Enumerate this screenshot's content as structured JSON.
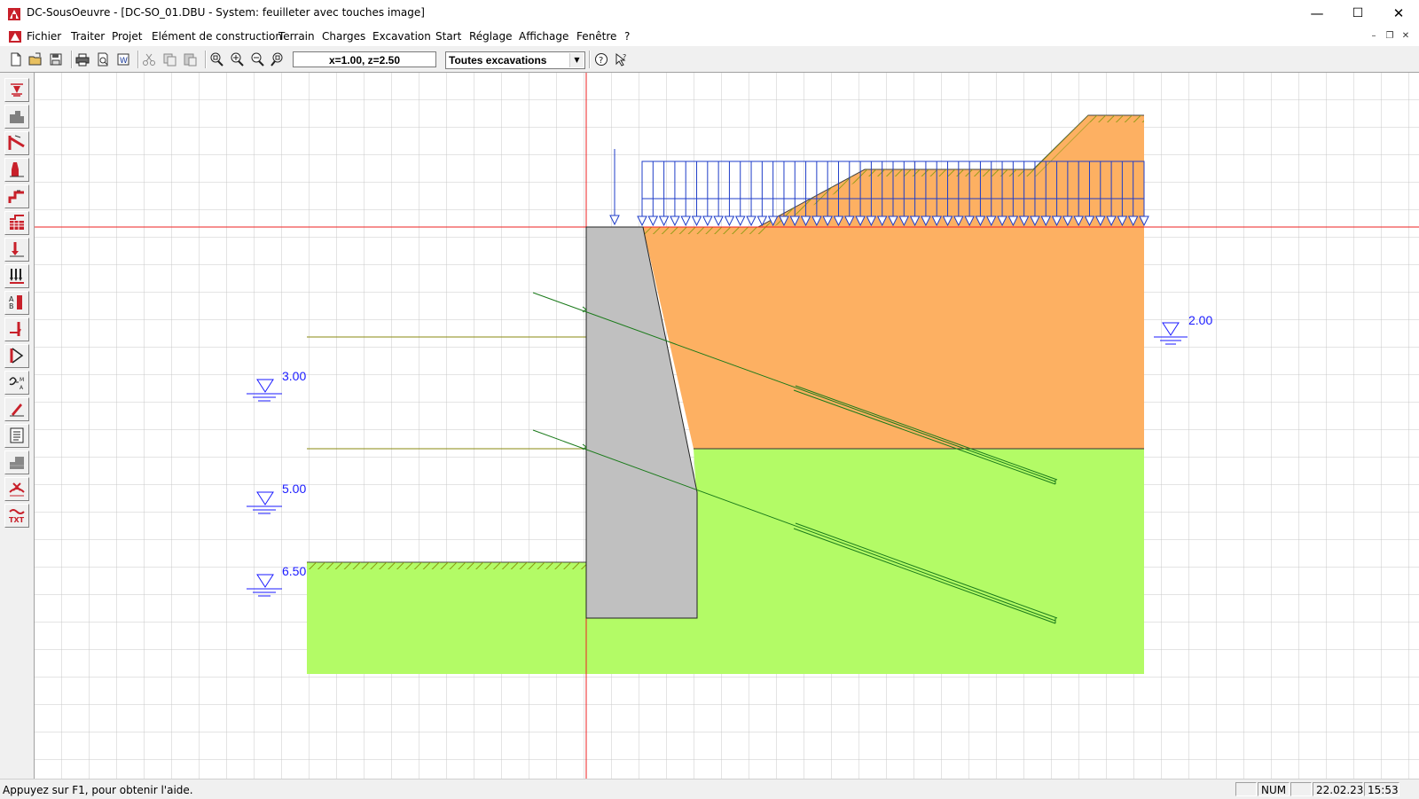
{
  "window": {
    "title": "DC-SousOeuvre - [DC-SO_01.DBU - System: feuilleter avec touches image]",
    "buttons": {
      "minimize": "—",
      "maximize": "☐",
      "close": "✕"
    }
  },
  "menu": {
    "items": [
      "Fichier",
      "Traiter",
      "Projet",
      "Elément de construction",
      "Terrain",
      "Charges",
      "Excavation",
      "Start",
      "Réglage",
      "Affichage",
      "Fenêtre",
      "?"
    ],
    "mdi_buttons": {
      "minimize": "–",
      "restore": "❐",
      "close": "✕"
    }
  },
  "toolbar": {
    "coordinates": "x=1.00, z=2.50",
    "excavation_select": "Toutes excavations"
  },
  "left_toolbar": {
    "icons": [
      "water-level-icon",
      "ground-layers-icon",
      "anchor-icon",
      "wall-element-icon",
      "excavation-stage-icon",
      "soil-layer-table-icon",
      "point-load-icon",
      "distributed-load-icon",
      "anchor-list-icon",
      "wall-step-icon",
      "earth-pressure-icon",
      "section-forces-icon",
      "pen-edit-icon",
      "report-icon",
      "foundation-icon",
      "delete-load-icon",
      "text-tool-icon"
    ],
    "text_label": "TXT"
  },
  "drawing": {
    "levels": [
      "2.00",
      "3.00",
      "5.00",
      "6.50"
    ],
    "colors": {
      "upper_soil": "#fdb062",
      "lower_soil": "#b3fb66",
      "wall": "#c0c0c0",
      "load": "#1f3dc8",
      "anchor": "#1a7a1a",
      "axis": "#ee2222",
      "level_marker": "#1a1aff",
      "hatch": "#8a9a10"
    }
  },
  "status": {
    "help_text": "Appuyez sur F1, pour obtenir l'aide.",
    "num": "NUM",
    "date": "22.02.23",
    "time": "15:53"
  }
}
